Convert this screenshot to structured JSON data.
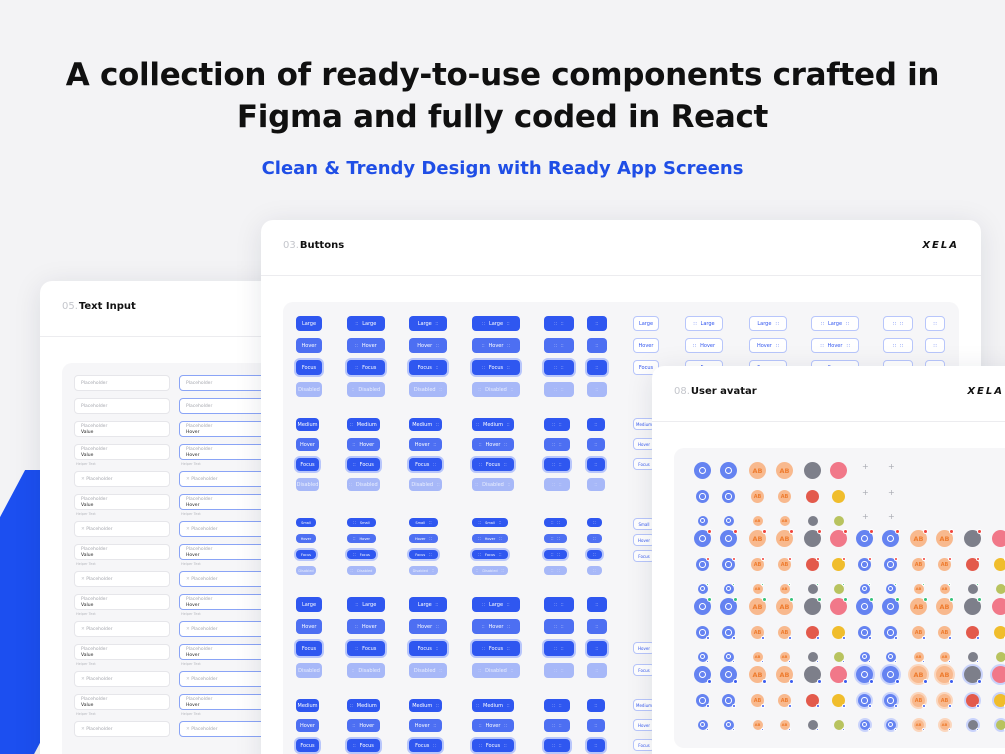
{
  "headline": {
    "line1": "A collection of ready-to-use components crafted in",
    "line2": "Figma and fully coded in React"
  },
  "subheadline": "Clean & Trendy Design with Ready App Screens",
  "panels": {
    "text_input": {
      "number": "05.",
      "title": "Text Input",
      "placeholder": "Placeholder",
      "value_label": "Value",
      "hover_label": "Hover",
      "helper_text": "Helper Text"
    },
    "buttons": {
      "number": "03.",
      "title": "Buttons",
      "logo": "XELA",
      "states": [
        "Large",
        "Hover",
        "Focus",
        "Disabled"
      ],
      "medium_states": [
        "Medium",
        "Hover",
        "Focus",
        "Disabled"
      ],
      "small_states": [
        "Small",
        "Hover",
        "Focus",
        "Disabled"
      ]
    },
    "user_avatar": {
      "number": "08.",
      "title": "User avatar",
      "logo": "XELA",
      "initials": "AB"
    }
  },
  "colors": {
    "accent": "#1f4ee6",
    "button_primary": "#2f57f0",
    "button_disabled": "#a7b8f8",
    "avatar_text_bg": "#f8b98e",
    "avatar_text_fg": "#ee7c2f"
  }
}
